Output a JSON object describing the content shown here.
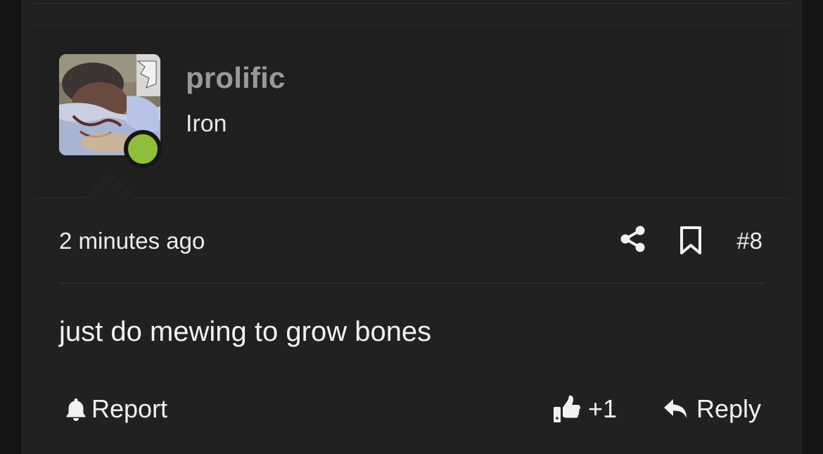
{
  "user": {
    "name": "prolific",
    "title": "Iron",
    "online_status_color": "#8fbf3a"
  },
  "post": {
    "timestamp": "2 minutes ago",
    "number": "#8",
    "body": "just do mewing to grow bones"
  },
  "actions": {
    "report_label": "Report",
    "like_count": "+1",
    "reply_label": "Reply"
  },
  "icons": {
    "share": "share-icon",
    "bookmark": "bookmark-icon",
    "report": "bell-icon",
    "like": "thumbs-up-icon",
    "reply": "reply-arrow-icon"
  },
  "colors": {
    "page_background": "#212121",
    "card_background": "#1f1f1f",
    "text_primary": "#f2f2f2",
    "username_color": "#9a9a9a"
  }
}
